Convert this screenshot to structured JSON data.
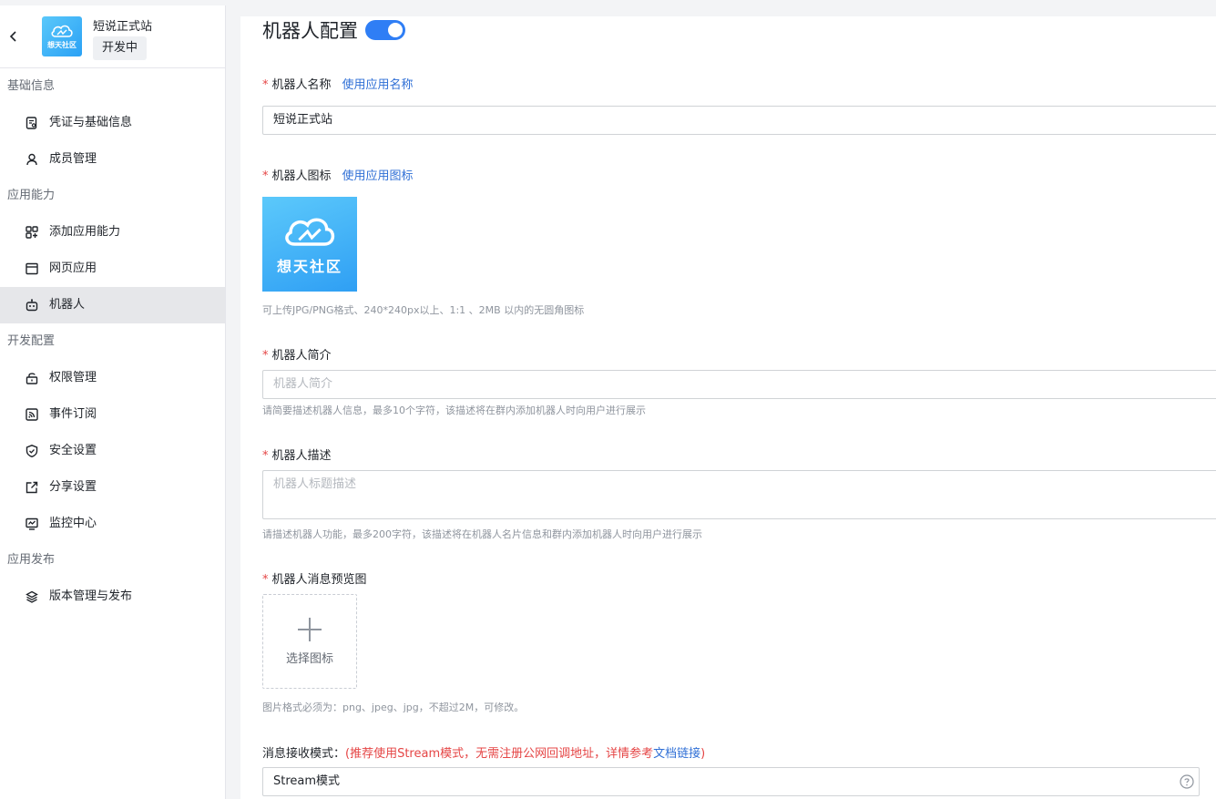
{
  "app": {
    "name": "短说正式站",
    "status": "开发中",
    "logo_text": "想天社区"
  },
  "sidebar": {
    "sections": [
      {
        "title": "基础信息",
        "items": [
          {
            "label": "凭证与基础信息",
            "icon": "credential-icon"
          },
          {
            "label": "成员管理",
            "icon": "user-icon"
          }
        ]
      },
      {
        "title": "应用能力",
        "items": [
          {
            "label": "添加应用能力",
            "icon": "add-capability-icon"
          },
          {
            "label": "网页应用",
            "icon": "webpage-icon"
          },
          {
            "label": "机器人",
            "icon": "robot-icon",
            "active": true
          }
        ]
      },
      {
        "title": "开发配置",
        "items": [
          {
            "label": "权限管理",
            "icon": "lock-icon"
          },
          {
            "label": "事件订阅",
            "icon": "rss-icon"
          },
          {
            "label": "安全设置",
            "icon": "shield-icon"
          },
          {
            "label": "分享设置",
            "icon": "share-icon"
          },
          {
            "label": "监控中心",
            "icon": "monitor-icon"
          }
        ]
      },
      {
        "title": "应用发布",
        "items": [
          {
            "label": "版本管理与发布",
            "icon": "layers-icon"
          }
        ]
      }
    ]
  },
  "main": {
    "title": "机器人配置",
    "toggle_on": true,
    "name_field": {
      "label": "机器人名称",
      "link": "使用应用名称",
      "value": "短说正式站"
    },
    "icon_field": {
      "label": "机器人图标",
      "link": "使用应用图标",
      "icon_text": "想天社区",
      "hint": "可上传JPG/PNG格式、240*240px以上、1:1 、2MB 以内的无圆角图标"
    },
    "intro_field": {
      "label": "机器人简介",
      "placeholder": "机器人简介",
      "hint": "请简要描述机器人信息，最多10个字符，该描述将在群内添加机器人时向用户进行展示"
    },
    "desc_field": {
      "label": "机器人描述",
      "placeholder": "机器人标题描述",
      "hint": "请描述机器人功能，最多200字符，该描述将在机器人名片信息和群内添加机器人时向用户进行展示"
    },
    "preview_field": {
      "label": "机器人消息预览图",
      "upload_text": "选择图标",
      "hint": "图片格式必须为：png、jpeg、jpg，不超过2M，可修改。"
    },
    "mode_field": {
      "label": "消息接收模式：",
      "note_prefix": "(推荐使用Stream模式，无需注册公网回调地址，详情参考",
      "note_link": "文档链接",
      "note_suffix": ")",
      "value": "Stream模式"
    }
  },
  "colors": {
    "accent": "#2f7ef5",
    "required": "#e54545",
    "link": "#2f6fd6"
  }
}
